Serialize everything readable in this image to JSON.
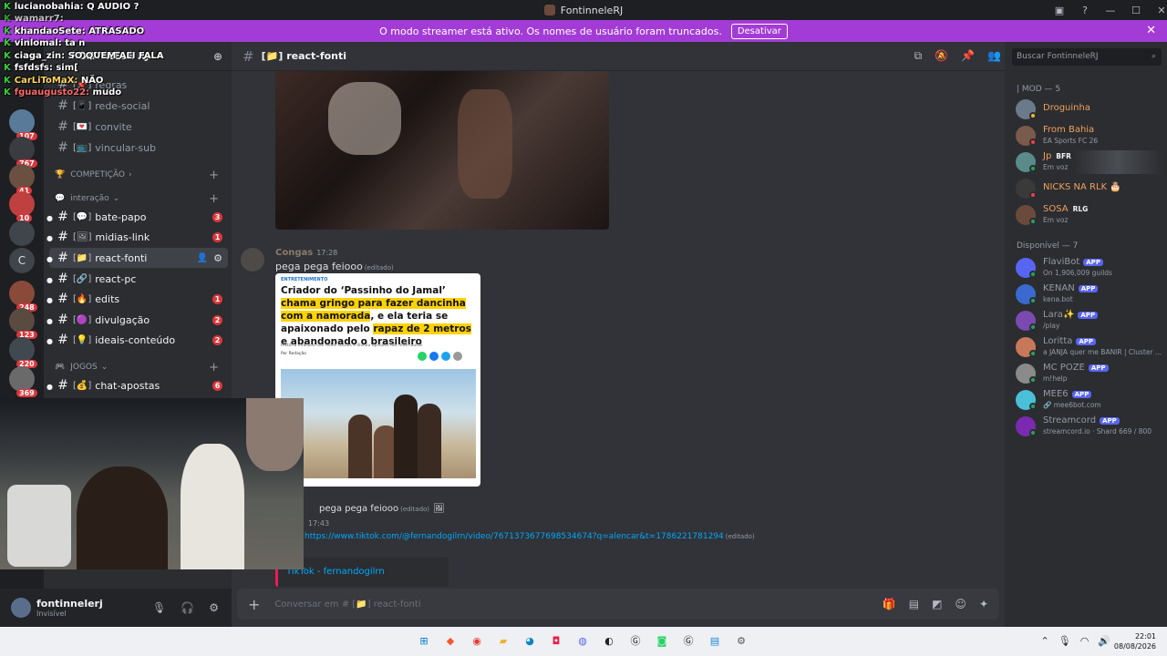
{
  "window": {
    "title": "FontinneleRJ",
    "controls": [
      "▣",
      "?",
      "—",
      "☐",
      "✕"
    ]
  },
  "banner": {
    "text": "O modo streamer está ativo. Os nomes de usuário foram truncados.",
    "button": "Desativar",
    "close": "✕"
  },
  "stream_overlay": [
    {
      "user": "lucianobahia:",
      "text": "Q AUDIO ?"
    },
    {
      "user": "wamarr7:",
      "text": ""
    },
    {
      "user": "khandaoSete:",
      "text": "ATRASADO"
    },
    {
      "user": "vinlomal:",
      "text": "ta n"
    },
    {
      "user": "ciaga_zin:",
      "text": "SO QUEM ALI FALA"
    },
    {
      "user": "fsfdsfs:",
      "text": "sim["
    },
    {
      "user": "CarLiToMaX:",
      "text": "NÃO"
    },
    {
      "user": "fguaugusto22:",
      "text": "mudo"
    }
  ],
  "server": {
    "name": "FONTINELE RJ"
  },
  "server_badges": [
    "107",
    "767",
    "41",
    "10",
    "248",
    "123",
    "220",
    "369"
  ],
  "server_letter": "C",
  "channels": {
    "top": [
      {
        "name": "regras",
        "emoji": "[📌]"
      },
      {
        "name": "rede-social",
        "emoji": "[📱]"
      },
      {
        "name": "convite",
        "emoji": "[💌]"
      },
      {
        "name": "vincular-sub",
        "emoji": "[📺]"
      }
    ],
    "cat_competicao": "COMPETIÇÃO",
    "cat_interacao": "interação",
    "interacao": [
      {
        "name": "bate-papo",
        "emoji": "[💬]",
        "count": "3"
      },
      {
        "name": "midias-link",
        "emoji": "[🖼]",
        "count": "1"
      },
      {
        "name": "react-fonti",
        "emoji": "[📁]",
        "count": ""
      },
      {
        "name": "react-pc",
        "emoji": "[🔗]",
        "count": ""
      },
      {
        "name": "edits",
        "emoji": "[🔥]",
        "count": "1"
      },
      {
        "name": "divulgação",
        "emoji": "[🟣]",
        "count": "2"
      },
      {
        "name": "ideais-conteúdo",
        "emoji": "[💡]",
        "count": "2"
      }
    ],
    "cat_jogos": "JOGOS",
    "jogos": [
      {
        "name": "chat-apostas",
        "emoji": "[💰]",
        "count": "6"
      }
    ]
  },
  "user": {
    "name": "fontinnelerj",
    "status": "Invisível"
  },
  "chat": {
    "channel": "react-fonti",
    "channel_emoji": "[📁]",
    "messages": [
      {
        "author": "Congas",
        "time": "17:28",
        "text": "pega pega feiooo",
        "edited": "(editado)"
      },
      {
        "author": "Congas",
        "time": "",
        "text": "pega pega feiooo",
        "edited": "(editado)"
      },
      {
        "author": "Congas",
        "time": "17:43",
        "link": "https://www.tiktok.com/@fernandogilrn/video/7671373677698534674?q=alencar&t=1786221781294",
        "edited": "(editado)"
      }
    ],
    "article": {
      "tag": "ENTRETENIMENTO",
      "headline_1": "Criador do ‘Passinho do Jamal’",
      "headline_2": "chama gringo para fazer dancinha",
      "headline_3": "com a namorada",
      "headline_4": ", e ela teria se apaixonado pelo",
      "headline_5": "rapaz de 2 metros",
      "headline_6": " e abandonado o brasileiro",
      "sub": "História viralizou nas redes sociais e dividiu opiniões dos internautas",
      "by": "Por Redação"
    },
    "embed_title": "TikTok - fernandogilrn",
    "composer_placeholder": "Conversar em # [📁] react-fonti",
    "reply_label": "pega pega feiooo"
  },
  "search": {
    "placeholder": "Buscar FontinneleRJ"
  },
  "members": {
    "group1": "| MOD — 5",
    "mods": [
      {
        "name": "Droguinha",
        "sub": "",
        "tag": "",
        "color": "#f0a05a"
      },
      {
        "name": "From Bahia",
        "sub": "EA Sports FC 26",
        "tag": "",
        "color": "#f0a05a"
      },
      {
        "name": "Jp",
        "sub": "Em voz",
        "tag": "BFR",
        "color": "#f0a05a"
      },
      {
        "name": "NICKS NA RLK",
        "sub": "",
        "tag": "🎂",
        "color": "#f0a05a"
      },
      {
        "name": "SOSA",
        "sub": "Em voz",
        "tag": "RLG",
        "color": "#f0a05a"
      }
    ],
    "group2": "Disponível — 7",
    "online": [
      {
        "name": "FlaviBot",
        "sub": "On 1,906,009 guilds",
        "badge": "APP"
      },
      {
        "name": "KENAN",
        "sub": "kena.bot",
        "badge": "APP"
      },
      {
        "name": "Lara✨",
        "sub": "/play",
        "badge": "APP"
      },
      {
        "name": "Loritta",
        "sub": "a JANJA quer me BANIR | Cluster ...",
        "badge": "APP"
      },
      {
        "name": "MC POZE",
        "sub": "m!help",
        "badge": "APP"
      },
      {
        "name": "MEE6",
        "sub": "mee6bot.com",
        "badge": "APP"
      },
      {
        "name": "Streamcord",
        "sub": "streamcord.io · Shard 669 / 800",
        "badge": "APP"
      }
    ]
  },
  "taskbar": {
    "time": "22:01",
    "date": "08/08/2026"
  },
  "colors": {
    "banner": "#a33cd6",
    "accent": "#5865f2",
    "badge": "#da373c",
    "link": "#00a8fc"
  }
}
